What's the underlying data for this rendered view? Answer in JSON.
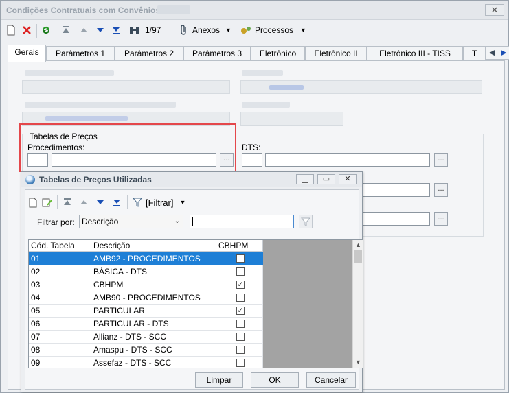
{
  "window": {
    "title": "Condições Contratuais com Convênios:"
  },
  "toolbar": {
    "record_position": "1/97",
    "anexos": "Anexos",
    "processos": "Processos"
  },
  "tabs": [
    "Gerais",
    "Parâmetros 1",
    "Parâmetros 2",
    "Parâmetros 3",
    "Eletrônico",
    "Eletrônico II",
    "Eletrônico III - TISS",
    "T"
  ],
  "form": {
    "group_title": "Tabelas de Preços",
    "procedimentos_label": "Procedimentos:",
    "dts_label": "DTS:",
    "ellipsis": "..."
  },
  "dialog": {
    "title": "Tabelas de Preços Utilizadas",
    "filter_button": "[Filtrar]",
    "filter_by_label": "Filtrar por:",
    "filter_by_value": "Descrição",
    "columns": [
      "Cód. Tabela",
      "Descrição",
      "CBHPM"
    ],
    "rows": [
      {
        "code": "01",
        "desc": "AMB92 - PROCEDIMENTOS",
        "cbhpm": "false"
      },
      {
        "code": "02",
        "desc": "BÁSICA - DTS",
        "cbhpm": "false"
      },
      {
        "code": "03",
        "desc": "CBHPM",
        "cbhpm": "true"
      },
      {
        "code": "04",
        "desc": "AMB90 - PROCEDIMENTOS",
        "cbhpm": "false"
      },
      {
        "code": "05",
        "desc": "PARTICULAR",
        "cbhpm": "true"
      },
      {
        "code": "06",
        "desc": "PARTICULAR - DTS",
        "cbhpm": "false"
      },
      {
        "code": "07",
        "desc": "Allianz - DTS - SCC",
        "cbhpm": "false"
      },
      {
        "code": "08",
        "desc": "Amaspu - DTS - SCC",
        "cbhpm": "false"
      },
      {
        "code": "09",
        "desc": "Assefaz - DTS - SCC",
        "cbhpm": "false"
      }
    ],
    "buttons": {
      "limpar": "Limpar",
      "ok": "OK",
      "cancelar": "Cancelar"
    }
  },
  "colors": {
    "selection": "#1e7fd6",
    "highlight_border": "#e4474b"
  }
}
